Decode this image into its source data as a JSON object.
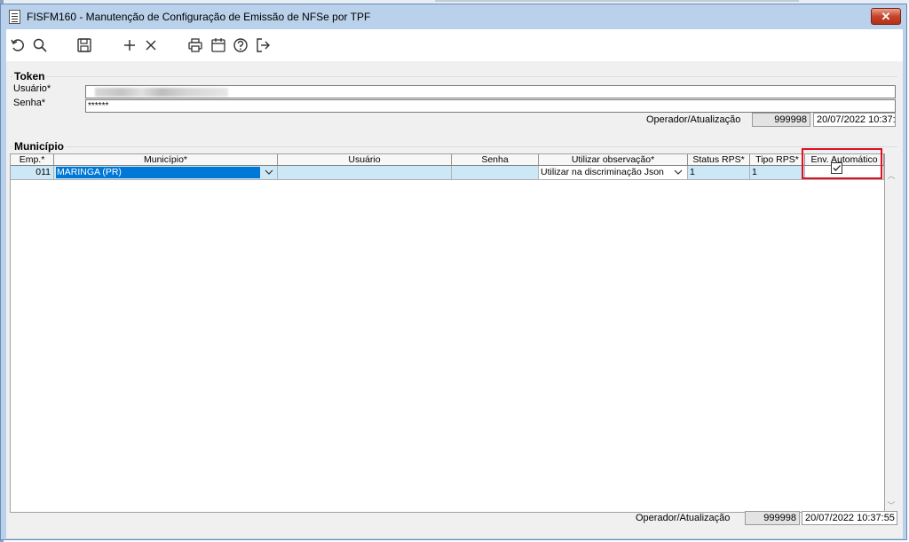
{
  "window": {
    "title": "FISFM160 - Manutenção de Configuração de Emissão de NFSe por TPF",
    "close_label": "✕"
  },
  "toolbar": {
    "icons": [
      "undo-icon",
      "search-icon",
      "save-icon",
      "add-icon",
      "delete-icon",
      "print-icon",
      "calendar-icon",
      "help-icon",
      "exit-icon"
    ]
  },
  "token": {
    "group_title": "Token",
    "usuario_label": "Usuário*",
    "usuario_value": "",
    "senha_label": "Senha*",
    "senha_value": "******",
    "operador_label": "Operador/Atualização",
    "operador_value": "999998",
    "data_value": "20/07/2022 10:37:"
  },
  "municipio": {
    "group_title": "Município",
    "columns": [
      "Emp.*",
      "Município*",
      "Usuário",
      "Senha",
      "Utilizar observação*",
      "Status RPS*",
      "Tipo RPS*",
      "Env. Automático"
    ],
    "rows": [
      {
        "emp": "011",
        "municipio": "MARINGA (PR)",
        "usuario": "",
        "senha": "",
        "observacao": "Utilizar na discriminação Json",
        "status_rps": "1",
        "tipo_rps": "1",
        "env_automatico": true
      }
    ]
  },
  "footer": {
    "operador_label": "Operador/Atualização",
    "operador_value": "999998",
    "data_value": "20/07/2022 10:37:55"
  },
  "colors": {
    "window_frame": "#b9d1ea",
    "selection": "#0078d7",
    "row_highlight": "#cce8f6",
    "annotation_box": "#e01020"
  }
}
